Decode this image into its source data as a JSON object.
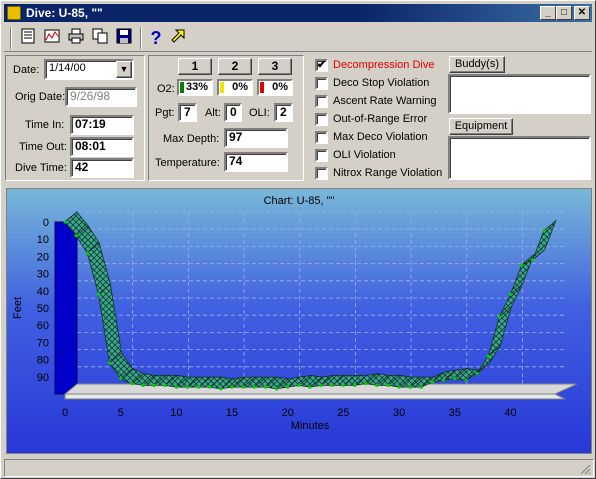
{
  "window": {
    "title": "Dive: U-85, \"\"",
    "min": "_",
    "max": "□",
    "close": "✕"
  },
  "toolbar": {
    "items": [
      "notes-icon",
      "chart-icon",
      "print-icon",
      "copy-icon",
      "save-icon",
      "help-icon",
      "pointer-icon"
    ]
  },
  "form": {
    "date_label": "Date:",
    "date_value": "1/14/00",
    "orig_date_label": "Orig Date:",
    "orig_date_value": "9/26/98",
    "time_in_label": "Time In:",
    "time_in_value": "07:19",
    "time_out_label": "Time Out:",
    "time_out_value": "08:01",
    "dive_time_label": "Dive Time:",
    "dive_time_value": "42"
  },
  "tanks": {
    "tabs": [
      "1",
      "2",
      "3"
    ],
    "o2_label": "O2:",
    "o2_values": [
      "33%",
      "0%",
      "0%"
    ],
    "o2_colors": [
      "#008000",
      "#e8e800",
      "#e00000"
    ],
    "pgt_label": "Pgt:",
    "pgt_value": "7",
    "alt_label": "Alt:",
    "alt_value": "0",
    "oli_label": "OLI:",
    "oli_value": "2",
    "max_depth_label": "Max Depth:",
    "max_depth_value": "97",
    "temperature_label": "Temperature:",
    "temperature_value": "74"
  },
  "flags": [
    {
      "label": "Decompression Dive",
      "checked": true,
      "color": "#e00000"
    },
    {
      "label": "Deco Stop Violation",
      "checked": false
    },
    {
      "label": "Ascent Rate Warning",
      "checked": false
    },
    {
      "label": "Out-of-Range Error",
      "checked": false
    },
    {
      "label": "Max Deco Violation",
      "checked": false
    },
    {
      "label": "OLI Violation",
      "checked": false
    },
    {
      "label": "Nitrox Range Violation",
      "checked": false
    }
  ],
  "buddy_button": "Buddy(s)",
  "equipment_button": "Equipment",
  "chart_data": {
    "type": "area",
    "title": "Chart: U-85, \"\"",
    "xlabel": "Minutes",
    "ylabel": "Feet",
    "xlim": [
      0,
      44
    ],
    "ylim": [
      0,
      100
    ],
    "y_inverted": true,
    "x_ticks": [
      0,
      5,
      10,
      15,
      20,
      25,
      30,
      35,
      40
    ],
    "y_ticks": [
      0,
      10,
      20,
      30,
      40,
      50,
      60,
      70,
      80,
      90
    ],
    "grid": true,
    "x": [
      0,
      1,
      2,
      3,
      4,
      5,
      6,
      7,
      8,
      9,
      10,
      11,
      12,
      13,
      14,
      15,
      16,
      17,
      18,
      19,
      20,
      21,
      22,
      23,
      24,
      25,
      26,
      27,
      28,
      29,
      30,
      31,
      32,
      33,
      34,
      35,
      36,
      37,
      38,
      39,
      40,
      41,
      42,
      43
    ],
    "values": [
      0,
      8,
      18,
      42,
      82,
      91,
      94,
      95,
      95,
      95,
      96,
      96,
      96,
      96,
      97,
      96,
      96,
      96,
      96,
      97,
      96,
      95,
      96,
      95,
      95,
      95,
      95,
      94,
      95,
      95,
      96,
      96,
      96,
      93,
      92,
      91,
      92,
      88,
      78,
      55,
      42,
      25,
      22,
      5
    ]
  }
}
